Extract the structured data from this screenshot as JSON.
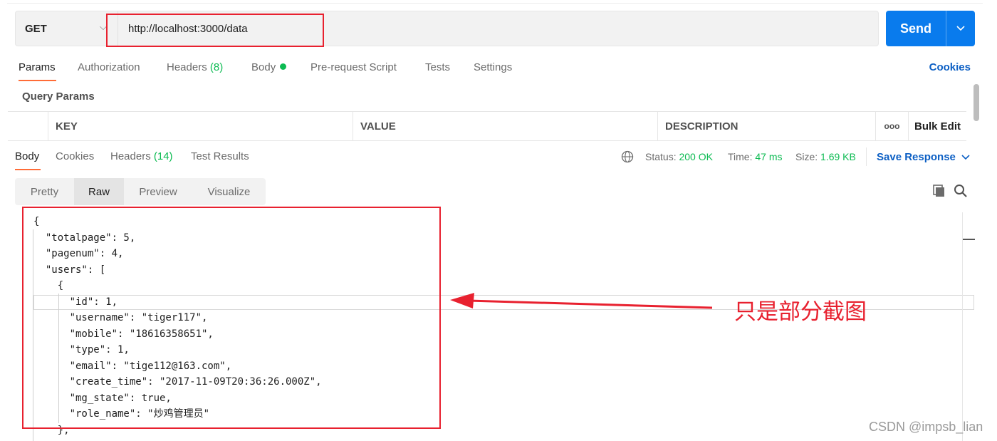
{
  "request": {
    "method": "GET",
    "url": "http://localhost:3000/data",
    "send_label": "Send"
  },
  "request_tabs": {
    "params": "Params",
    "authorization": "Authorization",
    "headers": "Headers",
    "headers_count": "(8)",
    "body": "Body",
    "prerequest": "Pre-request Script",
    "tests": "Tests",
    "settings": "Settings",
    "cookies": "Cookies"
  },
  "query_params": {
    "title": "Query Params",
    "columns": [
      "KEY",
      "VALUE",
      "DESCRIPTION"
    ],
    "more": "ooo",
    "bulk_edit": "Bulk Edit"
  },
  "response_tabs": {
    "body": "Body",
    "cookies": "Cookies",
    "headers": "Headers",
    "headers_count": "(14)",
    "test_results": "Test Results"
  },
  "response_status": {
    "status_label": "Status:",
    "status_value": "200 OK",
    "time_label": "Time:",
    "time_value": "47 ms",
    "size_label": "Size:",
    "size_value": "1.69 KB",
    "save_response": "Save Response"
  },
  "format_tabs": [
    "Pretty",
    "Raw",
    "Preview",
    "Visualize"
  ],
  "format_active": "Raw",
  "code_lines": [
    "{",
    "  \"totalpage\": 5,",
    "  \"pagenum\": 4,",
    "  \"users\": [",
    "    {",
    "      \"id\": 1,",
    "      \"username\": \"tiger117\",",
    "      \"mobile\": \"18616358651\",",
    "      \"type\": 1,",
    "      \"email\": \"tige112@163.com\",",
    "      \"create_time\": \"2017-11-09T20:36:26.000Z\",",
    "      \"mg_state\": true,",
    "      \"role_name\": \"炒鸡管理员\"",
    "    },"
  ],
  "annotation": "只是部分截图",
  "watermark": "CSDN @impsb_lian",
  "colors": {
    "accent_blue": "#097bed",
    "link_blue": "#0c5fc4",
    "success_green": "#0cbb52",
    "tab_orange": "#ff6c37",
    "annotation_red": "#e8212f"
  }
}
